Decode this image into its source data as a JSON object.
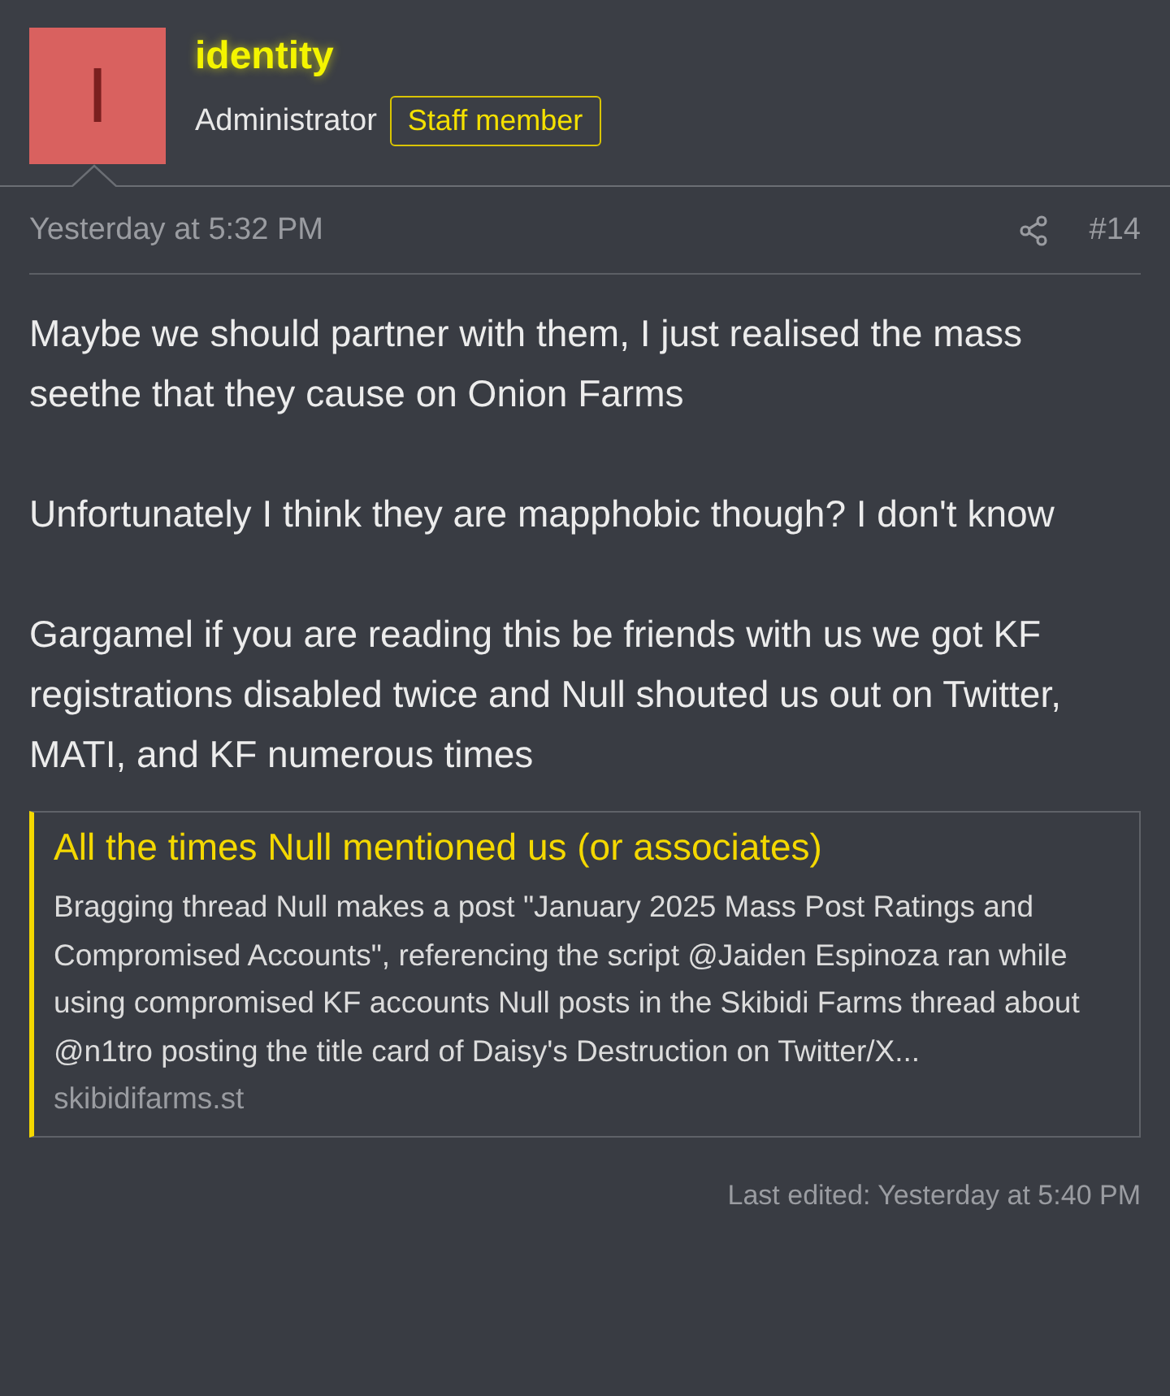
{
  "author": {
    "avatar_letter": "I",
    "name": "identity",
    "role": "Administrator",
    "badge": "Staff member"
  },
  "post": {
    "time": "Yesterday at 5:32 PM",
    "number": "#14",
    "paragraphs": [
      "Maybe we should partner with them, I just realised the mass seethe that they cause on Onion Farms",
      "Unfortunately I think they are mapphobic though? I don't know",
      "Gargamel if you are reading this be friends with us we got KF registrations disabled twice and Null shouted us out on Twitter, MATI, and KF numerous times"
    ]
  },
  "link_preview": {
    "title": "All the times Null mentioned us (or associates)",
    "description": "Bragging thread Null makes a post \"January 2025 Mass Post Ratings and Compromised Accounts\", referencing the script @Jaiden Espinoza ran while using compromised KF accounts Null posts in the Skibidi Farms thread about @n1tro posting the title card of Daisy's Destruction on Twitter/X...",
    "domain": "skibidifarms.st"
  },
  "last_edited": "Last edited: Yesterday at 5:40 PM"
}
